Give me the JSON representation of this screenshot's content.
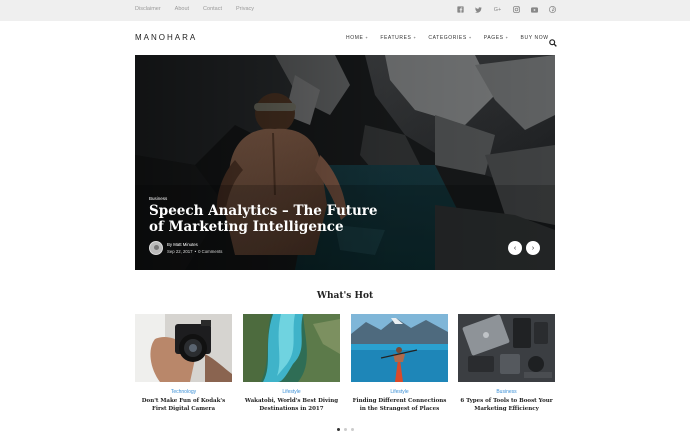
{
  "topbar": {
    "links": [
      "Disclaimer",
      "About",
      "Contact",
      "Privacy"
    ],
    "social_icons": [
      "facebook-icon",
      "twitter-icon",
      "google-plus-icon",
      "instagram-icon",
      "youtube-icon",
      "pinterest-icon"
    ],
    "social_glyphs": [
      "f",
      "t",
      "G+",
      "◎",
      "▶",
      "P"
    ]
  },
  "header": {
    "logo": "MANOHARA",
    "nav": [
      {
        "label": "HOME",
        "caret": "+"
      },
      {
        "label": "FEATURES",
        "caret": "+"
      },
      {
        "label": "CATEGORIES",
        "caret": "+"
      },
      {
        "label": "PAGES",
        "caret": "+"
      },
      {
        "label": "BUY NOW",
        "caret": ""
      }
    ]
  },
  "hero": {
    "category": "Business",
    "title": "Speech Analytics – The Future of Marketing Intelligence",
    "author": "By Matt Minutes",
    "date": "Sep 22, 2017",
    "comments": "0 Comments",
    "prev": "‹",
    "next": "›"
  },
  "whats_hot": {
    "title": "What's Hot",
    "cards": [
      {
        "category": "Technology",
        "title": "Don't Make Fun of Kodak's First Digital Camera"
      },
      {
        "category": "Lifestyle",
        "title": "Wakatobi, World's Best Diving Destinations in 2017"
      },
      {
        "category": "Lifestyle",
        "title": "Finding Different Connections in the Strangest of Places"
      },
      {
        "category": "Business",
        "title": "6 Types of Tools to Boost Your Marketing Efficiency"
      }
    ],
    "pagination": {
      "pages": 3,
      "active": 1
    }
  },
  "colors": {
    "accent": "#3a8fd6",
    "topbar_bg": "#efefef"
  }
}
